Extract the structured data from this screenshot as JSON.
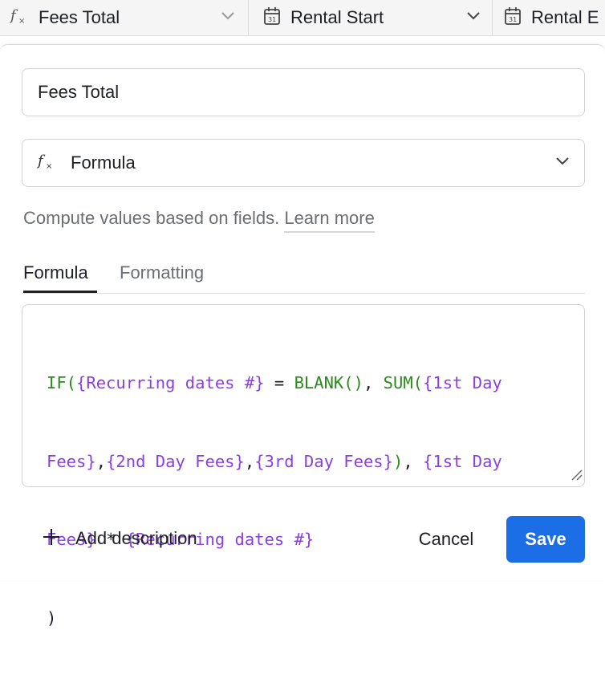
{
  "header": {
    "columns": [
      {
        "label": "Fees Total",
        "icon": "formula-icon"
      },
      {
        "label": "Rental Start",
        "icon": "calendar-icon"
      },
      {
        "label": "Rental E",
        "icon": "calendar-icon"
      }
    ]
  },
  "field": {
    "name_value": "Fees Total",
    "type_label": "Formula",
    "helper_text": "Compute values based on fields.",
    "learn_more": "Learn more"
  },
  "tabs": [
    {
      "label": "Formula",
      "active": true
    },
    {
      "label": "Formatting",
      "active": false
    }
  ],
  "formula": {
    "line1": [
      {
        "t": "IF(",
        "k": "fn"
      },
      {
        "t": "{Recurring dates #}",
        "k": "ref"
      },
      {
        "t": " = ",
        "k": "op"
      },
      {
        "t": "BLANK()",
        "k": "fn"
      },
      {
        "t": ", ",
        "k": "op"
      },
      {
        "t": "SUM(",
        "k": "fn"
      },
      {
        "t": "{1st Day",
        "k": "ref"
      }
    ],
    "line2": [
      {
        "t": "Fees}",
        "k": "ref"
      },
      {
        "t": ",",
        "k": "op"
      },
      {
        "t": "{2nd Day Fees}",
        "k": "ref"
      },
      {
        "t": ",",
        "k": "op"
      },
      {
        "t": "{3rd Day Fees}",
        "k": "ref"
      },
      {
        "t": ")",
        "k": "fn"
      },
      {
        "t": ", ",
        "k": "op"
      },
      {
        "t": "{1st Day",
        "k": "ref"
      }
    ],
    "line3": [
      {
        "t": "Fees}",
        "k": "ref"
      },
      {
        "t": " * ",
        "k": "op"
      },
      {
        "t": "{Recurring dates #}",
        "k": "ref"
      }
    ],
    "line4": [
      {
        "t": ")",
        "k": "op"
      }
    ]
  },
  "footer": {
    "add_description": "Add description",
    "cancel": "Cancel",
    "save": "Save"
  },
  "colors": {
    "function": "#2b8a1e",
    "field_reference": "#8a3fe0",
    "save_button": "#1b6ee6"
  }
}
